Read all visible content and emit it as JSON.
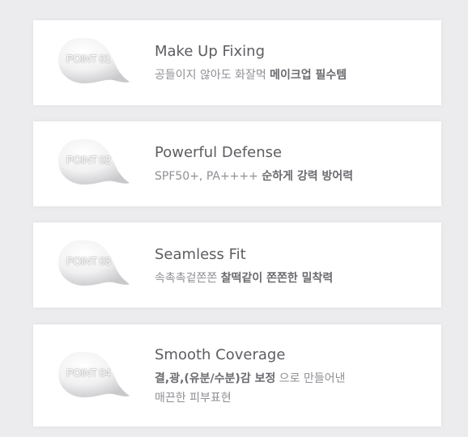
{
  "colors": {
    "page_background": "#ececee",
    "card_background": "#ffffff",
    "title_text": "#5d5d62",
    "description_text": "#8f8f95",
    "emphasis_text": "#6a6a70",
    "cream_blob": "#f4f4f5"
  },
  "points": [
    {
      "badge": "POINT 01",
      "title": "Make Up Fixing",
      "desc_plain": "공들이지 않아도 화잘먹",
      "desc_bold": "메이크업 필수템"
    },
    {
      "badge": "POINT 02",
      "title": "Powerful Defense",
      "desc_plain": "SPF50+, PA++++",
      "desc_bold": "순하게 강력 방어력"
    },
    {
      "badge": "POINT 03",
      "title": "Seamless Fit",
      "desc_plain": "속촉촉겉쫀쫀",
      "desc_bold": "찰떡같이 쫀쫀한 밀착력"
    },
    {
      "badge": "POINT 04",
      "title": "Smooth Coverage",
      "desc_bold": "결,광,(유분/수분)감 보정",
      "desc_plain": "으로 만들어낸",
      "desc_line2": "매끈한 피부표현"
    }
  ]
}
